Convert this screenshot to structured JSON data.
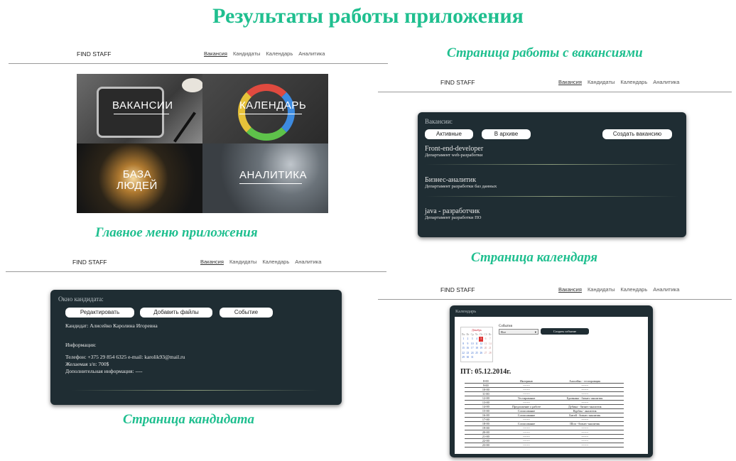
{
  "main_title": "Результаты работы приложения",
  "captions": {
    "main_menu": "Главное меню приложения",
    "vacancies": "Страница работы с вакансиями",
    "calendar": "Страница календаря",
    "candidate": "Страница кандидата"
  },
  "nav": {
    "logo": "FIND STAFF",
    "items": [
      "Вакансия",
      "Кандидаты",
      "Календарь",
      "Аналитика"
    ]
  },
  "tiles": [
    "ВАКАНСИИ",
    "КАЛЕНДАРЬ",
    "БАЗА\nЛЮДЕЙ",
    "АНАЛИТИКА"
  ],
  "vacancies_page": {
    "heading": "Вакансии:",
    "buttons": [
      "Активные",
      "В архиве",
      "Создать вакансию"
    ],
    "list": [
      {
        "title": "Front-end-developer",
        "dept": "Департамент web-разработки"
      },
      {
        "title": "Бизнес-аналитик",
        "dept": "Департамент разработки баз данных"
      },
      {
        "title": "java - разработчик",
        "dept": "Департамент разработки ПО"
      }
    ]
  },
  "candidate_page": {
    "heading": "Окно кандидата:",
    "buttons": [
      "Редактировать",
      "Добавить файлы",
      "Событие"
    ],
    "candidate": "Кандидат: Алисейко Каролина Игоревна",
    "info_label": "Информация:",
    "contacts": "Телефон: +375 29 854 6325 e-mail: karolik93@mail.ru",
    "salary": "Желаемая з/п: 700$",
    "extra": "Дополнительная информация: ----"
  },
  "calendar_page": {
    "heading": "Календарь",
    "mini_month": "Декабрь",
    "mini_days_header": [
      "Пн",
      "Вт",
      "Ср",
      "Чт",
      "Пт",
      "Сб",
      "Вс"
    ],
    "mini_weeks": [
      [
        "1",
        "2",
        "3",
        "4",
        "5",
        "6",
        "7"
      ],
      [
        "8",
        "9",
        "10",
        "11",
        "12",
        "13",
        "14"
      ],
      [
        "15",
        "16",
        "17",
        "18",
        "19",
        "20",
        "21"
      ],
      [
        "22",
        "23",
        "24",
        "25",
        "26",
        "27",
        "28"
      ],
      [
        "29",
        "30",
        "31",
        "",
        "",
        "",
        ""
      ]
    ],
    "events_label": "События",
    "events_select": "Все",
    "create_button": "Создать событие",
    "date_heading": "ПТ: 05.12.2014г.",
    "schedule": [
      [
        "8-00",
        "Интервью",
        "Алисейко - тестировщик"
      ],
      [
        "9-00",
        "-------",
        "-------"
      ],
      [
        "10-00",
        "-------",
        "-------"
      ],
      [
        "11-00",
        "-------",
        "-------"
      ],
      [
        "12-00",
        "Тестирование",
        "Бровкина - бизнес-аналитик"
      ],
      [
        "13-00",
        "-------",
        "-------"
      ],
      [
        "14-00",
        "Предложение о работе",
        "Дубина - бизнес-аналитик"
      ],
      [
        "15-00",
        "Согласование",
        "Курбан - аналитик"
      ],
      [
        "16-00",
        "Согласование",
        "Битей - бизнес-аналитик"
      ],
      [
        "17-00",
        "-------",
        "-------"
      ],
      [
        "18-00",
        "Согласование",
        "Шоп - бизнес-аналитик"
      ],
      [
        "19-00",
        "-------",
        "-------"
      ],
      [
        "20-00",
        "-------",
        "-------"
      ],
      [
        "21-00",
        "-------",
        "-------"
      ],
      [
        "22-00",
        "-------",
        "-------"
      ],
      [
        "23-00",
        "-------",
        "-------"
      ]
    ]
  }
}
